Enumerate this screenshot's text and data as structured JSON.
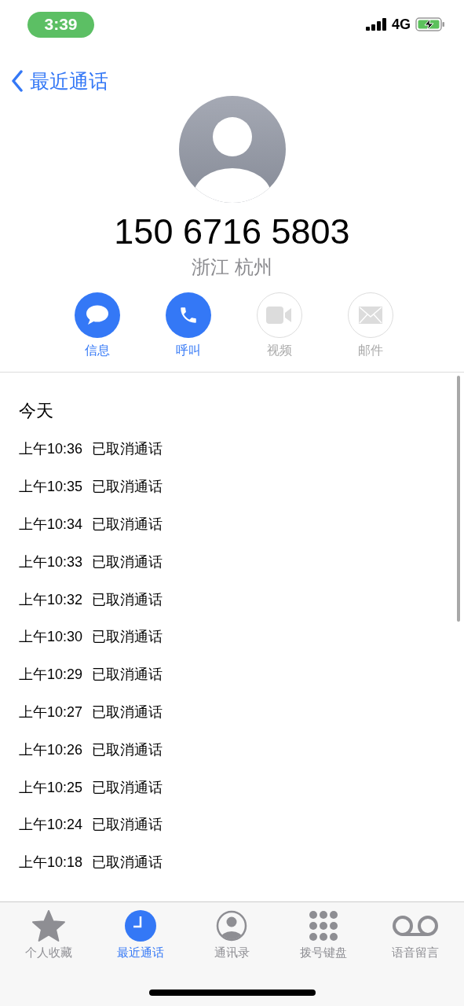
{
  "status_bar": {
    "time": "3:39",
    "network": "4G"
  },
  "nav": {
    "back_label": "最近通话"
  },
  "contact": {
    "number": "150 6716 5803",
    "location": "浙江 杭州"
  },
  "actions": [
    {
      "kind": "message",
      "label": "信息",
      "disabled": false
    },
    {
      "kind": "call",
      "label": "呼叫",
      "disabled": false
    },
    {
      "kind": "video",
      "label": "视频",
      "disabled": true
    },
    {
      "kind": "mail",
      "label": "邮件",
      "disabled": true
    }
  ],
  "history": {
    "heading": "今天",
    "calls": [
      {
        "time": "上午10:36",
        "status": "已取消通话"
      },
      {
        "time": "上午10:35",
        "status": "已取消通话"
      },
      {
        "time": "上午10:34",
        "status": "已取消通话"
      },
      {
        "time": "上午10:33",
        "status": "已取消通话"
      },
      {
        "time": "上午10:32",
        "status": "已取消通话"
      },
      {
        "time": "上午10:30",
        "status": "已取消通话"
      },
      {
        "time": "上午10:29",
        "status": "已取消通话"
      },
      {
        "time": "上午10:27",
        "status": "已取消通话"
      },
      {
        "time": "上午10:26",
        "status": "已取消通话"
      },
      {
        "time": "上午10:25",
        "status": "已取消通话"
      },
      {
        "time": "上午10:24",
        "status": "已取消通话"
      },
      {
        "time": "上午10:18",
        "status": "已取消通话"
      }
    ]
  },
  "tab_bar": [
    {
      "kind": "favorites",
      "label": "个人收藏",
      "selected": false
    },
    {
      "kind": "recents",
      "label": "最近通话",
      "selected": true
    },
    {
      "kind": "contacts",
      "label": "通讯录",
      "selected": false
    },
    {
      "kind": "keypad",
      "label": "拨号键盘",
      "selected": false
    },
    {
      "kind": "voicemail",
      "label": "语音留言",
      "selected": false
    }
  ]
}
